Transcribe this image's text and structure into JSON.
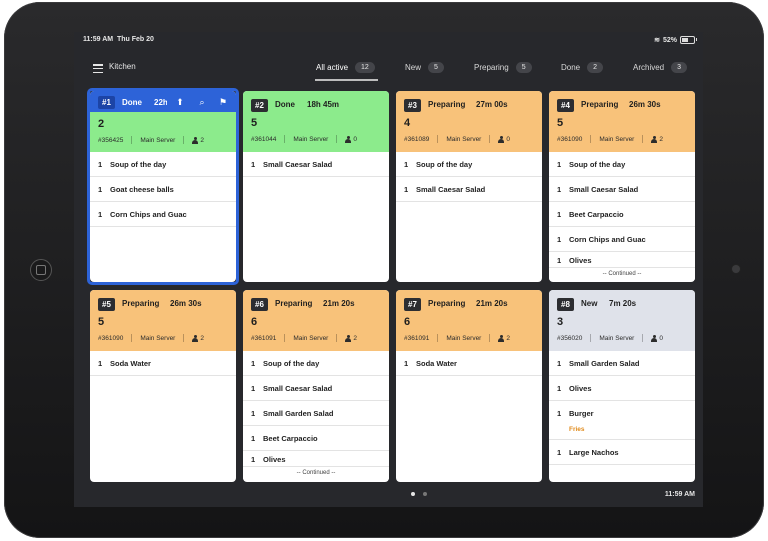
{
  "status_bar": {
    "time": "11:59 AM",
    "date": "Thu Feb 20",
    "battery": "52%"
  },
  "header": {
    "title": "Kitchen",
    "tabs": [
      {
        "label": "All active",
        "count": "12"
      },
      {
        "label": "New",
        "count": "5"
      },
      {
        "label": "Preparing",
        "count": "5"
      },
      {
        "label": "Done",
        "count": "2"
      },
      {
        "label": "Archived",
        "count": "3"
      }
    ]
  },
  "colors": {
    "done": "#8ceb8c",
    "preparing": "#f8c27a",
    "new": "#dfe2ea",
    "selected": "#2d63d8"
  },
  "orders": [
    {
      "num": "#1",
      "status": "Done",
      "elapsed": "22h",
      "table": "2",
      "check": "#356425",
      "server": "Main Server",
      "guests": "2",
      "items": [
        {
          "qty": "1",
          "name": "Soup of the day"
        },
        {
          "qty": "1",
          "name": "Goat cheese balls"
        },
        {
          "qty": "1",
          "name": "Corn Chips and Guac"
        }
      ]
    },
    {
      "num": "#2",
      "status": "Done",
      "elapsed": "18h 45m",
      "table": "5",
      "check": "#361044",
      "server": "Main Server",
      "guests": "0",
      "items": [
        {
          "qty": "1",
          "name": "Small Caesar Salad"
        }
      ]
    },
    {
      "num": "#3",
      "status": "Preparing",
      "elapsed": "27m 00s",
      "table": "4",
      "check": "#361089",
      "server": "Main Server",
      "guests": "0",
      "items": [
        {
          "qty": "1",
          "name": "Soup of the day"
        },
        {
          "qty": "1",
          "name": "Small Caesar Salad"
        }
      ]
    },
    {
      "num": "#4",
      "status": "Preparing",
      "elapsed": "26m 30s",
      "table": "5",
      "check": "#361090",
      "server": "Main Server",
      "guests": "2",
      "items": [
        {
          "qty": "1",
          "name": "Soup of the day"
        },
        {
          "qty": "1",
          "name": "Small Caesar Salad"
        },
        {
          "qty": "1",
          "name": "Beet Carpaccio"
        },
        {
          "qty": "1",
          "name": "Corn Chips and Guac"
        },
        {
          "qty": "1",
          "name": "Olives"
        }
      ],
      "continued": "-- Continued --"
    },
    {
      "num": "#5",
      "status": "Preparing",
      "elapsed": "26m 30s",
      "table": "5",
      "check": "#361090",
      "server": "Main Server",
      "guests": "2",
      "items": [
        {
          "qty": "1",
          "name": "Soda Water"
        }
      ]
    },
    {
      "num": "#6",
      "status": "Preparing",
      "elapsed": "21m 20s",
      "table": "6",
      "check": "#361091",
      "server": "Main Server",
      "guests": "2",
      "items": [
        {
          "qty": "1",
          "name": "Soup of the day"
        },
        {
          "qty": "1",
          "name": "Small Caesar Salad"
        },
        {
          "qty": "1",
          "name": "Small Garden Salad"
        },
        {
          "qty": "1",
          "name": "Beet Carpaccio"
        },
        {
          "qty": "1",
          "name": "Olives"
        }
      ],
      "continued": "-- Continued --"
    },
    {
      "num": "#7",
      "status": "Preparing",
      "elapsed": "21m 20s",
      "table": "6",
      "check": "#361091",
      "server": "Main Server",
      "guests": "2",
      "items": [
        {
          "qty": "1",
          "name": "Soda Water"
        }
      ]
    },
    {
      "num": "#8",
      "status": "New",
      "elapsed": "7m 20s",
      "table": "3",
      "check": "#356020",
      "server": "Main Server",
      "guests": "0",
      "items": [
        {
          "qty": "1",
          "name": "Small Garden Salad"
        },
        {
          "qty": "1",
          "name": "Olives"
        },
        {
          "qty": "1",
          "name": "Burger",
          "modifier": "Fries"
        },
        {
          "qty": "1",
          "name": "Large Nachos"
        }
      ]
    }
  ],
  "selected_actions": [
    "recall-icon",
    "search-icon",
    "flag-icon"
  ],
  "footer": {
    "clock": "11:59 AM"
  }
}
